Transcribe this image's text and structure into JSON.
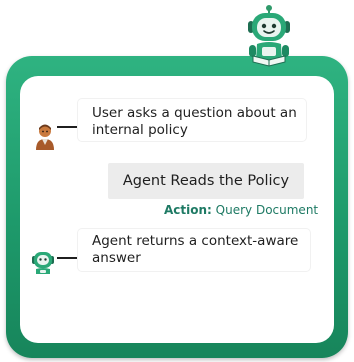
{
  "user_message": "User asks a question about an internal policy",
  "step_label": "Agent Reads the Policy",
  "action": {
    "prefix": "Action:",
    "value": "Query Document"
  },
  "agent_message": "Agent returns a context-aware answer",
  "icons": {
    "mascot": "robot-mascot-icon",
    "user": "user-avatar-icon",
    "agent": "robot-agent-icon"
  },
  "colors": {
    "frame_green": "#1e9a6b",
    "action_teal": "#1e7a64"
  }
}
